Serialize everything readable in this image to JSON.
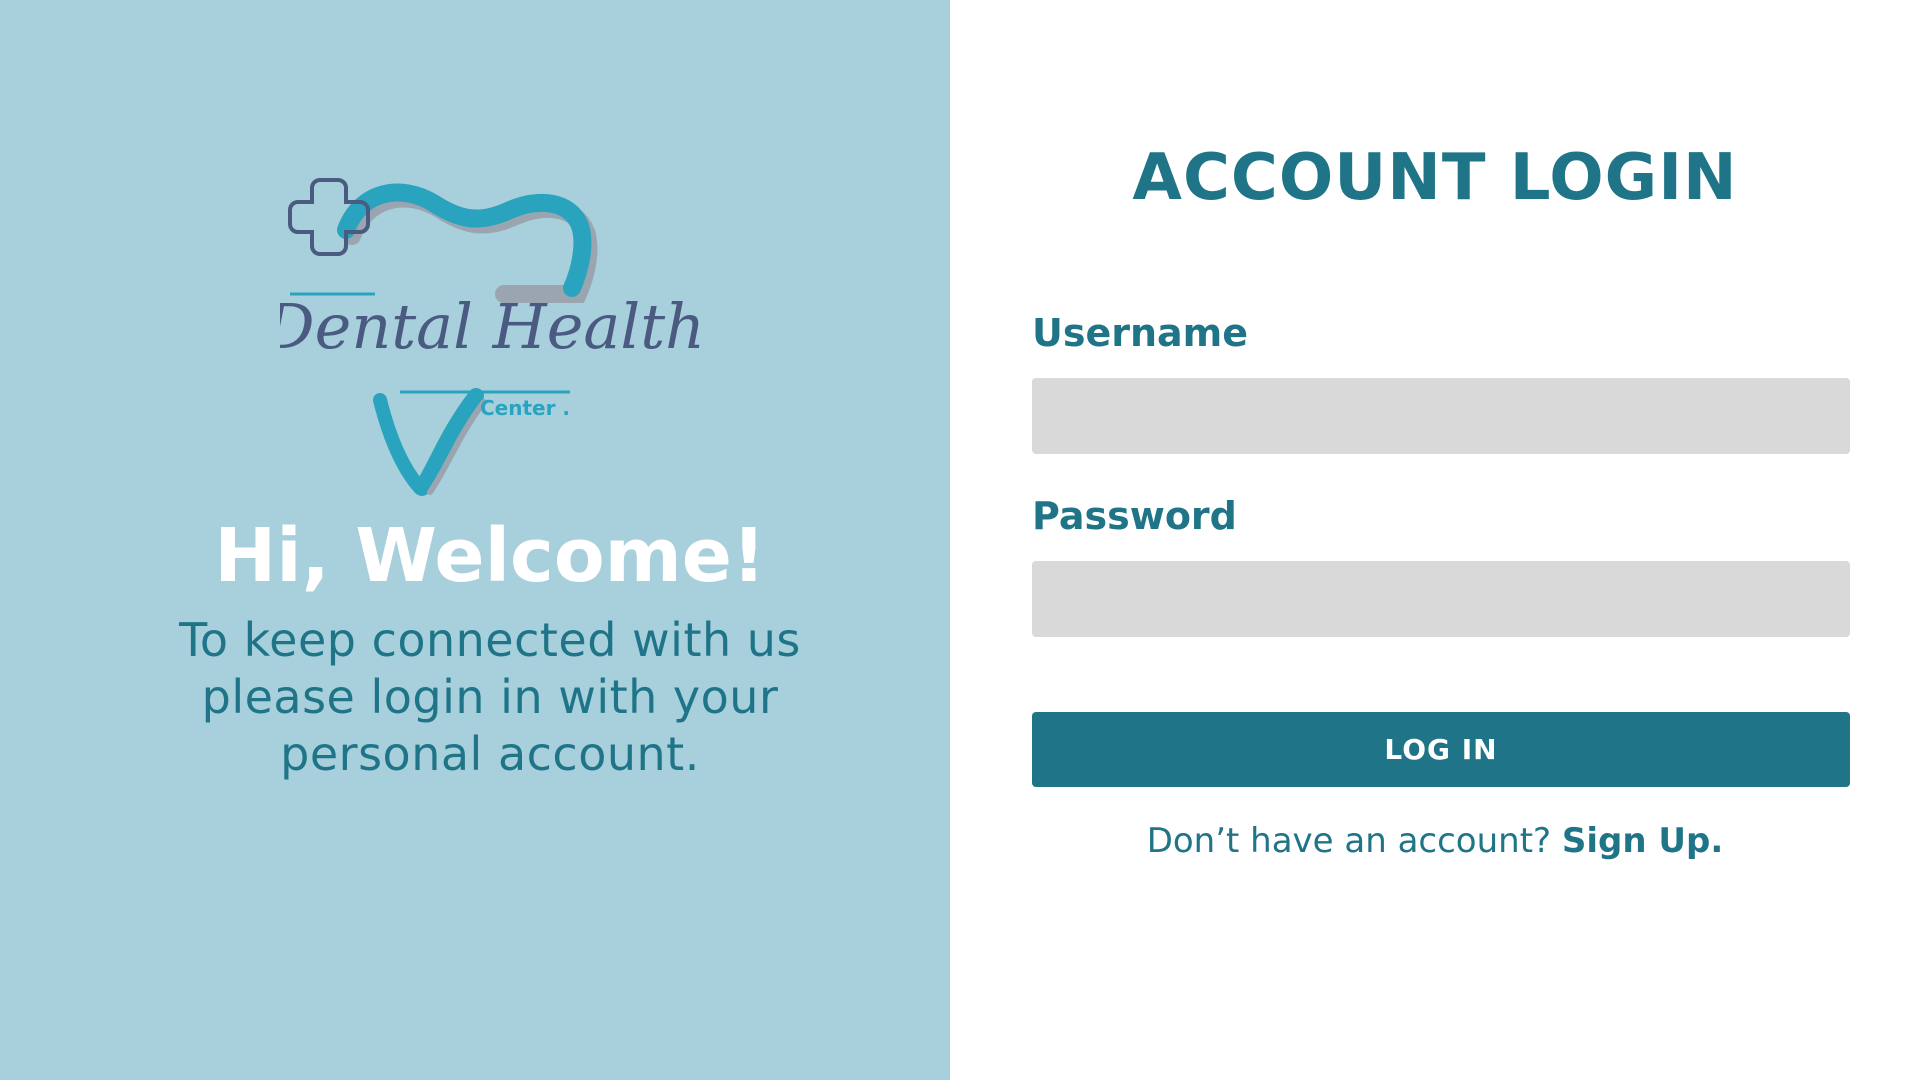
{
  "brand": {
    "logo_script_text": "Dental Health",
    "logo_subtext": "Center ."
  },
  "welcome": {
    "title": "Hi, Welcome!",
    "message": "To keep connected with us please login in with your personal account."
  },
  "login": {
    "title": "ACCOUNT LOGIN",
    "username_label": "Username",
    "username_value": "",
    "password_label": "Password",
    "password_value": "",
    "button_label": "LOG IN",
    "signup_prompt": "Don’t have an account?",
    "signup_link": "Sign Up."
  },
  "colors": {
    "left_panel_bg": "#a7d0dc",
    "accent": "#1f7587",
    "logo_teal": "#2aa3bf",
    "logo_navy": "#4a5a80",
    "input_bg": "#d9d9d9",
    "page_bg": "#ffffff"
  }
}
